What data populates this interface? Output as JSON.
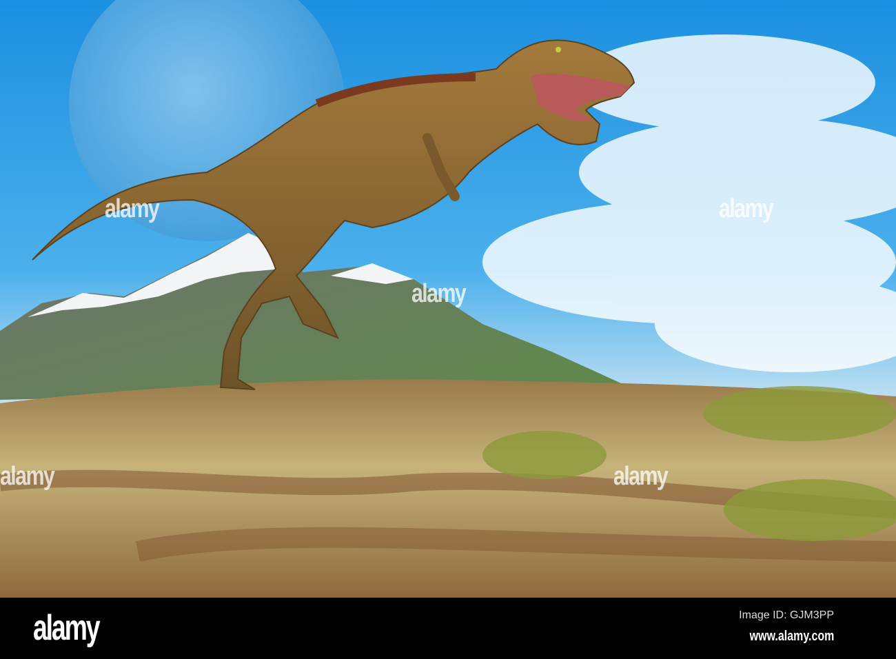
{
  "watermark": "alamy",
  "footer": {
    "logo": "alamy",
    "image_id": "Image ID: GJM3PP",
    "website": "www.alamy.com"
  }
}
